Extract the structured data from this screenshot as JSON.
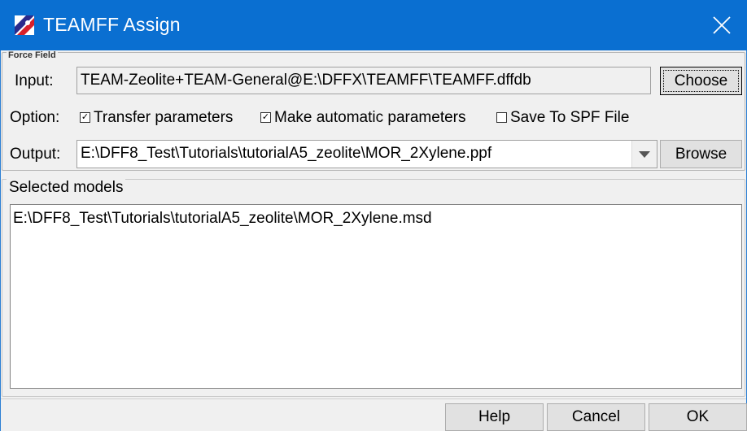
{
  "window": {
    "title": "TEAMFF Assign",
    "titlebar_color": "#0a6fd1"
  },
  "force_field": {
    "legend": "Force Field",
    "input_label": "Input:",
    "input_value": "TEAM-Zeolite+TEAM-General@E:\\DFFX\\TEAMFF\\TEAMFF.dffdb",
    "choose_label": "Choose"
  },
  "options": {
    "label": "Option:",
    "transfer_parameters": {
      "label": "Transfer parameters",
      "checked": true
    },
    "make_automatic_parameters": {
      "label": "Make automatic parameters",
      "checked": true
    },
    "save_to_spf_file": {
      "label": "Save To SPF File",
      "checked": false
    }
  },
  "output": {
    "label": "Output:",
    "value": "E:\\DFF8_Test\\Tutorials\\tutorialA5_zeolite\\MOR_2Xylene.ppf",
    "browse_label": "Browse"
  },
  "selected_models": {
    "legend": "Selected models",
    "items": [
      "E:\\DFF8_Test\\Tutorials\\tutorialA5_zeolite\\MOR_2Xylene.msd"
    ]
  },
  "buttons": {
    "help": "Help",
    "cancel": "Cancel",
    "ok": "OK"
  }
}
